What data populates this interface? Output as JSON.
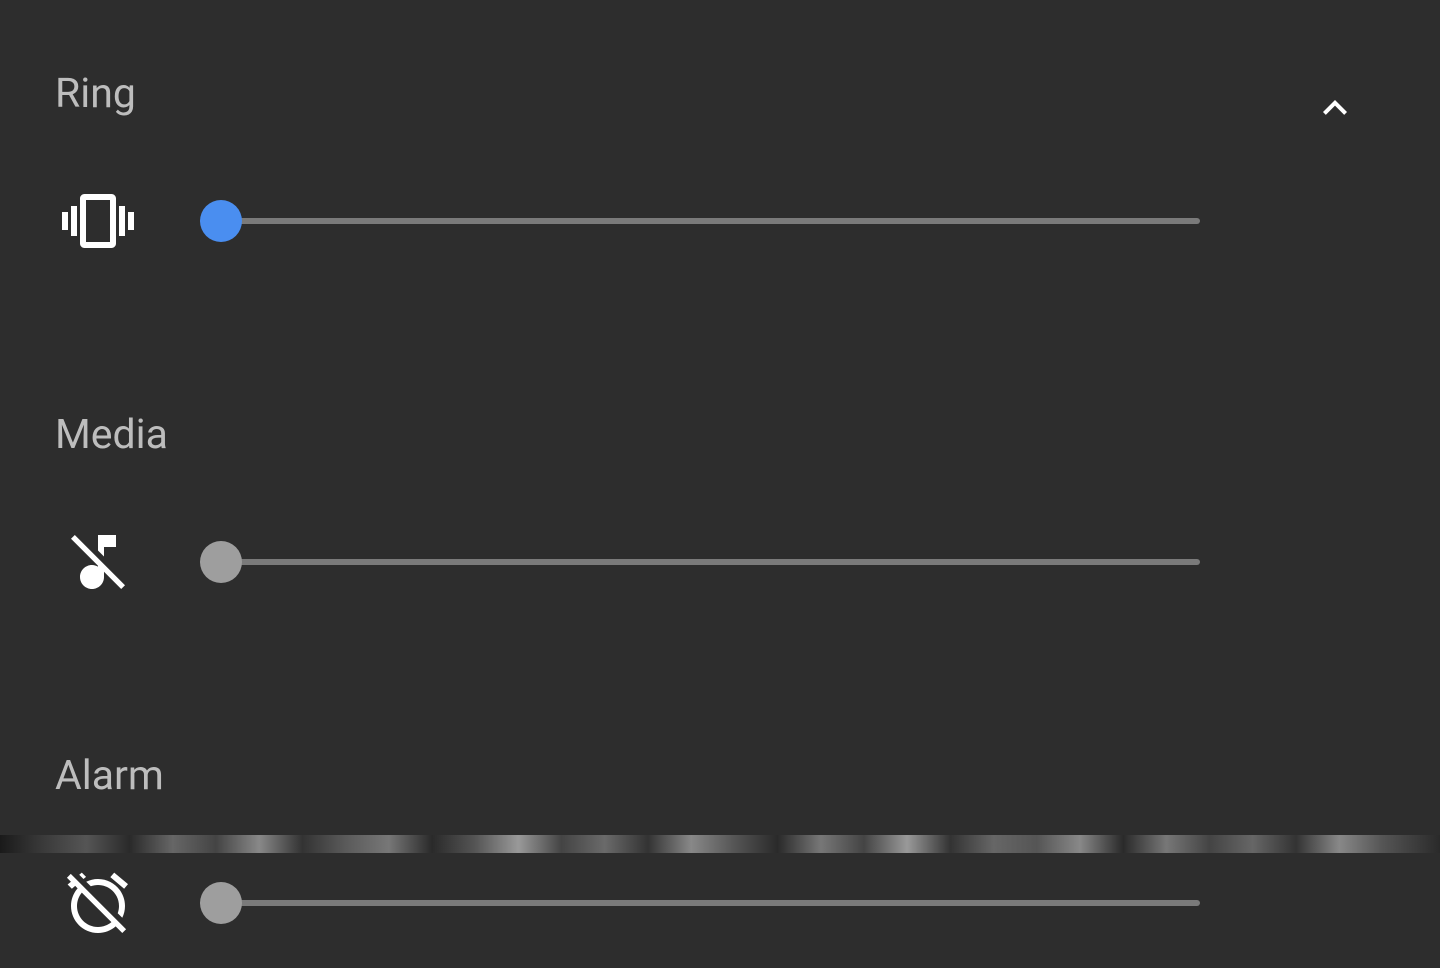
{
  "sections": {
    "ring": {
      "label": "Ring",
      "icon": "vibrate-icon",
      "value": 0,
      "active": true
    },
    "media": {
      "label": "Media",
      "icon": "music-off-icon",
      "value": 0,
      "active": false
    },
    "alarm": {
      "label": "Alarm",
      "icon": "alarm-off-icon",
      "value": 0,
      "active": false
    }
  },
  "colors": {
    "background": "#2d2d2d",
    "label": "#bdbdbd",
    "track": "#7a7a7a",
    "thumb_active": "#4a8ef0",
    "thumb_inactive": "#9e9e9e",
    "icon": "#ffffff"
  }
}
